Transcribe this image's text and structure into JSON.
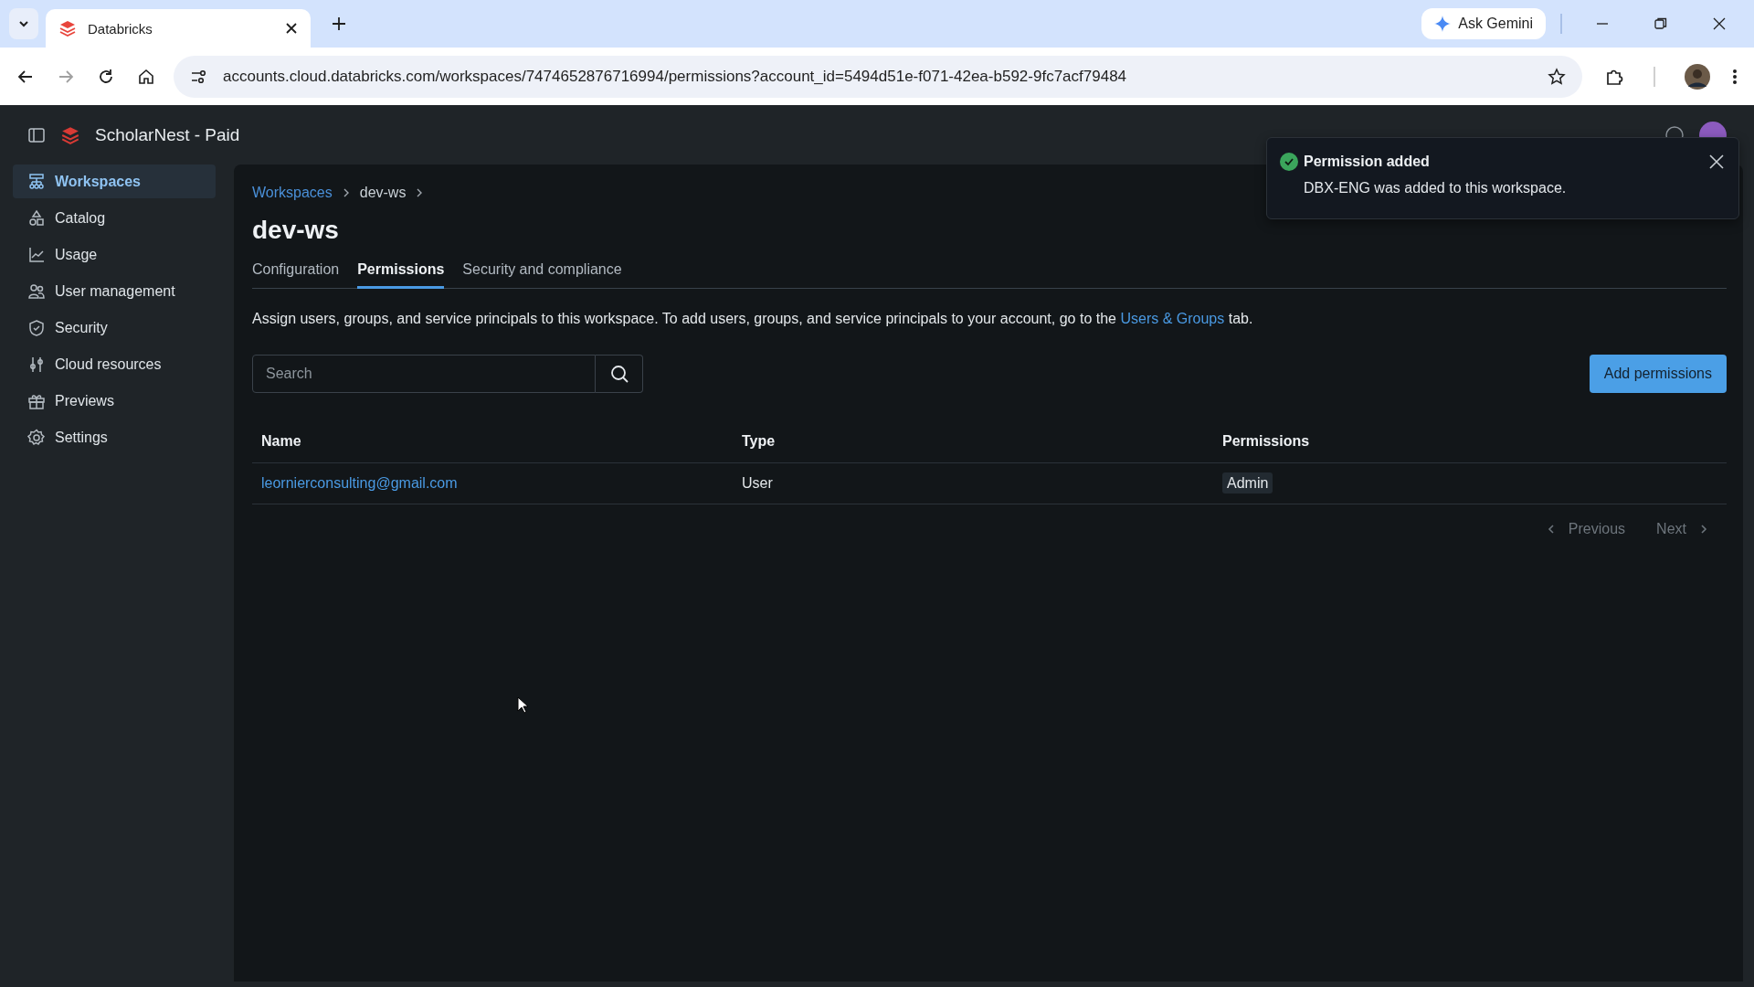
{
  "browser": {
    "tabs": [
      {
        "title": "Databricks",
        "selected": true
      }
    ],
    "ask_button": "Ask Gemini",
    "url": "accounts.cloud.databricks.com/workspaces/7474652876716994/permissions?account_id=5494d51e-f071-42ea-b592-9fc7acf79484"
  },
  "app": {
    "account_name": "ScholarNest - Paid"
  },
  "sidebar": {
    "items": [
      {
        "label": "Workspaces",
        "kind": "workspaces",
        "selected": true
      },
      {
        "label": "Catalog",
        "kind": "catalog",
        "selected": false
      },
      {
        "label": "Usage",
        "kind": "usage",
        "selected": false
      },
      {
        "label": "User management",
        "kind": "users",
        "selected": false
      },
      {
        "label": "Security",
        "kind": "security",
        "selected": false
      },
      {
        "label": "Cloud resources",
        "kind": "cloud",
        "selected": false
      },
      {
        "label": "Previews",
        "kind": "previews",
        "selected": false
      },
      {
        "label": "Settings",
        "kind": "settings",
        "selected": false
      }
    ]
  },
  "breadcrumbs": [
    {
      "label": "Workspaces",
      "kind": "link"
    },
    {
      "label": "dev-ws",
      "kind": "current"
    }
  ],
  "title": "dev-ws",
  "tabs": [
    {
      "label": "Configuration",
      "selected": false
    },
    {
      "label": "Permissions",
      "selected": true
    },
    {
      "label": "Security and compliance",
      "selected": false
    }
  ],
  "description": {
    "before": "Assign users, groups, and service principals to this workspace. To add users, groups, and service principals to your account, go to the",
    "link": "Users & Groups",
    "after": "tab."
  },
  "search": {
    "placeholder": "Search"
  },
  "add_button": "Add permissions",
  "table": {
    "columns": [
      "Name",
      "Type",
      "Permissions"
    ],
    "rows": [
      {
        "name": "leornierconsulting@gmail.com",
        "type": "User",
        "permission": "Admin"
      }
    ]
  },
  "pagination": {
    "previous": {
      "label": "Previous",
      "disabled": true
    },
    "next": {
      "label": "Next",
      "disabled": true
    }
  },
  "toast": {
    "title": "Permission added",
    "message": "DBX-ENG was added to this workspace."
  }
}
